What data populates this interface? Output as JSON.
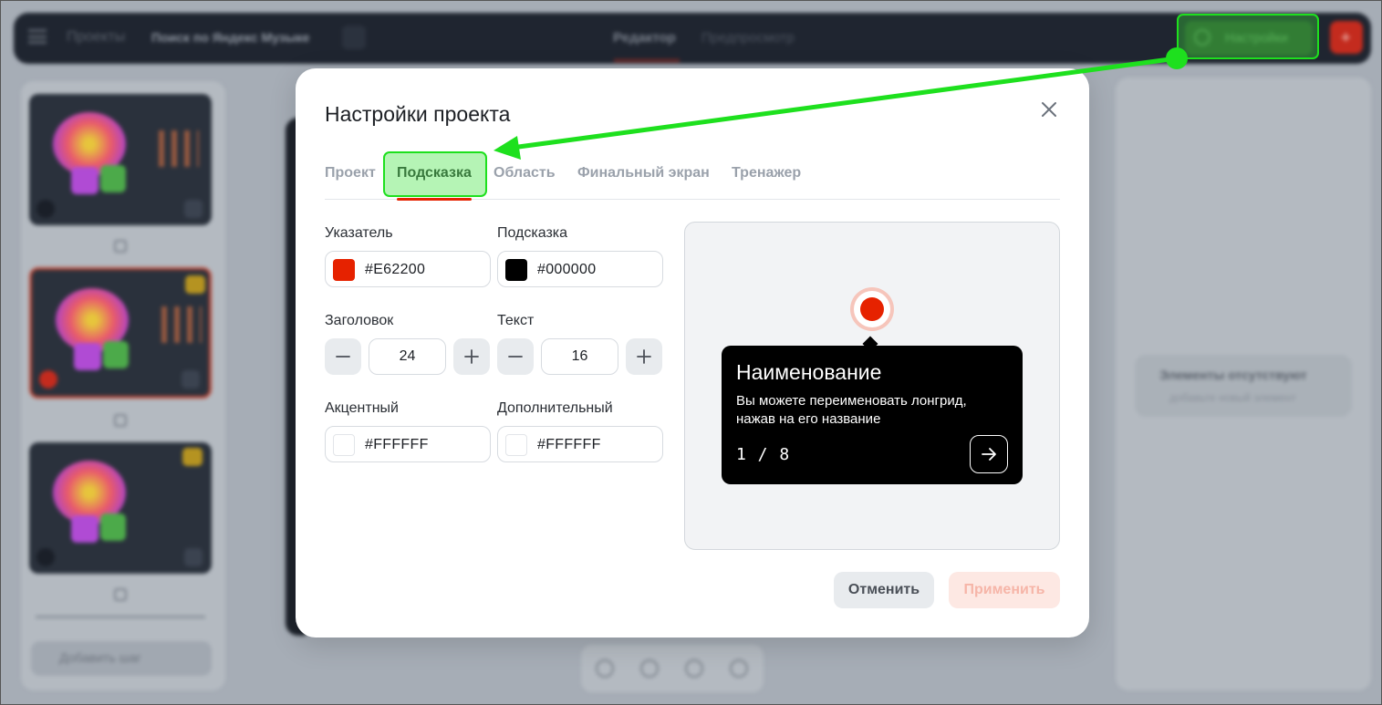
{
  "background": {
    "breadcrumb": "Проекты",
    "project_name": "Поиск по Яндекс Музыке",
    "tabs": [
      "Редактор",
      "Предпросмотр"
    ],
    "settings_label": "Настройки",
    "add_slide_label": "Добавить шаг",
    "empty_title": "Элементы отсутствуют",
    "empty_subtitle": "добавьте новый элемент"
  },
  "modal": {
    "title": "Настройки проекта",
    "tabs": [
      "Проект",
      "Подсказка",
      "Область",
      "Финальный экран",
      "Тренажер"
    ],
    "active_tab": "Подсказка",
    "fields": {
      "pointer": {
        "label": "Указатель",
        "value": "#E62200",
        "color": "#E62200"
      },
      "hint": {
        "label": "Подсказка",
        "value": "#000000",
        "color": "#000000"
      },
      "heading": {
        "label": "Заголовок",
        "value": "24"
      },
      "text": {
        "label": "Текст",
        "value": "16"
      },
      "accent": {
        "label": "Акцентный",
        "value": "#FFFFFF",
        "color": "#FFFFFF"
      },
      "additional": {
        "label": "Дополнительный",
        "value": "#FFFFFF",
        "color": "#FFFFFF"
      }
    },
    "preview": {
      "title": "Наименование",
      "text": "Вы можете переименовать лонгрид, нажав на его название",
      "counter": "1 / 8"
    },
    "buttons": {
      "cancel": "Отменить",
      "apply": "Применить"
    }
  },
  "colors": {
    "accent": "#E62200",
    "annotation": "#1EE01E"
  }
}
